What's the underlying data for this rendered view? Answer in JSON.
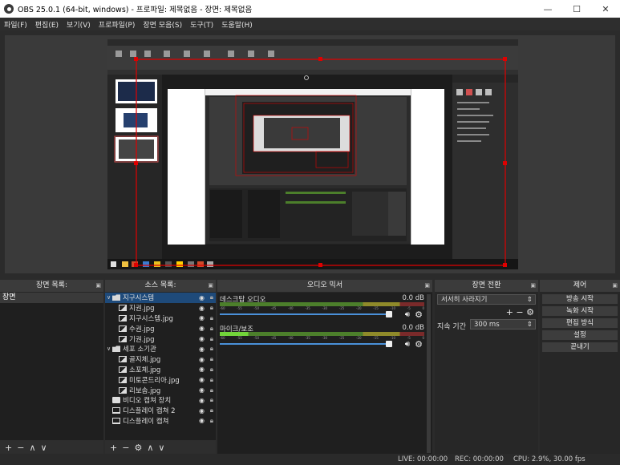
{
  "window": {
    "title": "OBS 25.0.1 (64-bit, windows) - 프로파일: 제목없음 - 장면: 제목없음",
    "minimize": "—",
    "maximize": "☐",
    "close": "✕"
  },
  "menu": [
    "파일(F)",
    "편집(E)",
    "보기(V)",
    "프로파일(P)",
    "장면 모음(S)",
    "도구(T)",
    "도움말(H)"
  ],
  "panels": {
    "scenes": {
      "title": "장면 목록:",
      "items": [
        "장면"
      ],
      "footer": [
        "+",
        "−",
        "∧",
        "∨"
      ]
    },
    "sources": {
      "title": "소스 목록:",
      "items": [
        {
          "label": "지구시스템",
          "type": "folder",
          "expanded": true,
          "selected": true,
          "indent": 0
        },
        {
          "label": "지권.jpg",
          "type": "image",
          "indent": 1
        },
        {
          "label": "지구시스템.jpg",
          "type": "image",
          "indent": 1
        },
        {
          "label": "수권.jpg",
          "type": "image",
          "indent": 1
        },
        {
          "label": "기권.jpg",
          "type": "image",
          "indent": 1
        },
        {
          "label": "세포 소기관",
          "type": "folder",
          "expanded": true,
          "indent": 0
        },
        {
          "label": "골지체.jpg",
          "type": "image",
          "indent": 1
        },
        {
          "label": "소포체.jpg",
          "type": "image",
          "indent": 1
        },
        {
          "label": "미토콘드리아.jpg",
          "type": "image",
          "indent": 1
        },
        {
          "label": "리보솜.jpg",
          "type": "image",
          "indent": 1
        },
        {
          "label": "비디오 캡쳐 장치",
          "type": "camera",
          "indent": 0
        },
        {
          "label": "디스플레이 캡쳐 2",
          "type": "monitor",
          "indent": 0
        },
        {
          "label": "디스플레이 캡쳐",
          "type": "monitor",
          "indent": 0
        }
      ],
      "footer": [
        "+",
        "−",
        "⚙",
        "∧",
        "∨"
      ]
    },
    "mixer": {
      "title": "오디오 믹서",
      "channels": [
        {
          "name": "데스크탑 오디오",
          "db": "0.0 dB",
          "level": 0
        },
        {
          "name": "마이크/보조",
          "db": "0.0 dB",
          "level": 0.14
        }
      ],
      "ticks": [
        "-60",
        "-55",
        "-50",
        "-45",
        "-40",
        "-35",
        "-30",
        "-25",
        "-20",
        "-15",
        "-10",
        "-5",
        "0"
      ]
    },
    "transitions": {
      "title": "장면 전환",
      "selected": "서서히 사라지기",
      "duration_label": "지속 기간",
      "duration_value": "300 ms",
      "footer": [
        "+",
        "−",
        "⚙"
      ]
    },
    "controls": {
      "title": "제어",
      "buttons": [
        "방송 시작",
        "녹화 시작",
        "편집 방식",
        "설정",
        "끝내기"
      ]
    }
  },
  "status": {
    "live": "LIVE: 00:00:00",
    "rec": "REC: 00:00:00",
    "cpu": "CPU: 2.9%, 30.00 fps"
  },
  "colors": {
    "selection": "#1e4a7a",
    "bounding_box": "#e00000",
    "accent": "#4a90d9"
  }
}
